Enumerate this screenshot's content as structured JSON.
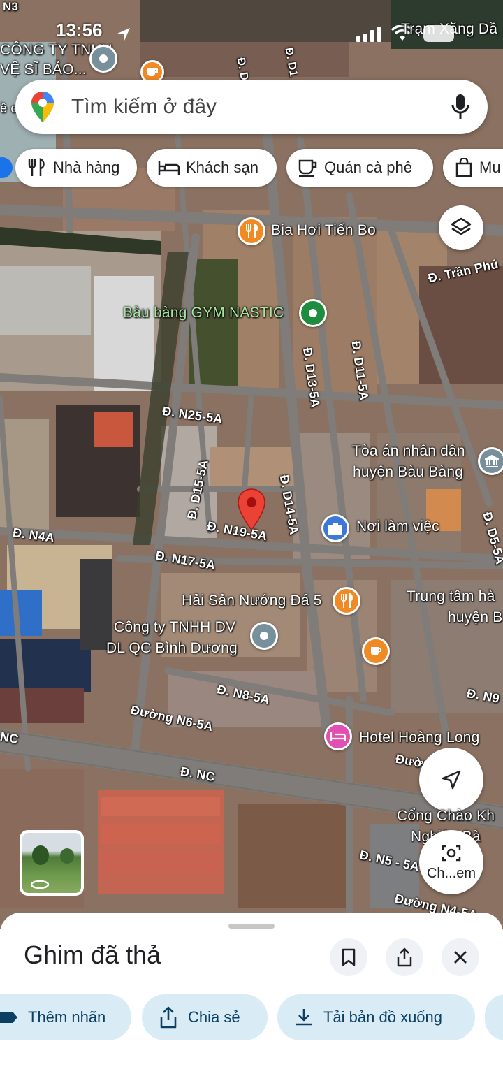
{
  "status_bar": {
    "time": "13:56",
    "carrier_label": "Trạm Xăng Dầ"
  },
  "search": {
    "placeholder": "Tìm kiếm ở đây"
  },
  "chips": [
    {
      "label": "Nhà hàng",
      "icon": "fork-knife-icon"
    },
    {
      "label": "Khách sạn",
      "icon": "bed-icon"
    },
    {
      "label": "Quán cà phê",
      "icon": "coffee-cup-icon"
    },
    {
      "label": "Mu",
      "icon": "shopping-bag-icon"
    }
  ],
  "map": {
    "roads": {
      "n25": "Đ. N25-5A",
      "n19": "Đ. N19-5A",
      "n17": "Đ. N17-5A",
      "n4a": "Đ. N4A",
      "n8": "Đ. N8-5A",
      "n6": "Đường N6-5A",
      "nc_left": "NC",
      "nc": "Đ. NC",
      "d15": "Đ. D15-5A",
      "d14": "Đ. D14-5A",
      "d13": "Đ. D13-5A",
      "d11": "Đ. D11-5A",
      "d5": "Đ. D5-5A",
      "tranphu": "Đ. Trần Phú",
      "n3": "N3",
      "n9": "Đ. N9",
      "n5": "Đ. N5 - 5A",
      "duong_right": "Đườn",
      "duong_n4": "Đường N4-5A",
      "top_d": "Đ. D",
      "top_d1": "Đ. D1"
    },
    "places": {
      "top_left_1": "CÔNG TY TNHH",
      "top_left_2": "VỆ SĨ BẢO...",
      "bia": "Bia Hơi Tiến Bo",
      "gym": "Bàu bàng GYM NASTIC",
      "toa_an_1": "Tòa án nhân dân",
      "toa_an_2": "huyện Bàu Bàng",
      "noi_lam_viec": "Nơi làm việc",
      "hai_san": "Hải Sản Nướng Đá 5",
      "trung_tam_1": "Trung tâm hà",
      "trung_tam_2": "huyện B",
      "cong_ty_1": "Công ty TNHH DV",
      "cong_ty_2": "DL QC Bình Dương",
      "hotel": "Hotel Hoàng Long",
      "cong_chao_1": "Cổng Chào Kh",
      "cong_chao_2": "Nghiệp Bà",
      "left_edge": "ề c"
    }
  },
  "camera_button": {
    "label": "Ch...em"
  },
  "sheet": {
    "title": "Ghim đã thả",
    "actions": [
      {
        "label": "Thêm nhãn",
        "icon": "label-tag-icon"
      },
      {
        "label": "Chia sẻ",
        "icon": "share-icon"
      },
      {
        "label": "Tải bản đồ xuống",
        "icon": "download-icon"
      }
    ]
  },
  "colors": {
    "pin_red": "#ea4335",
    "food_orange": "#f08a24",
    "work_blue": "#3c78d8",
    "hotel_pink": "#e24fb2",
    "park_green": "#1e8e3e",
    "generic_gray": "#78909c",
    "chip_action_bg": "#d9ecf5"
  }
}
